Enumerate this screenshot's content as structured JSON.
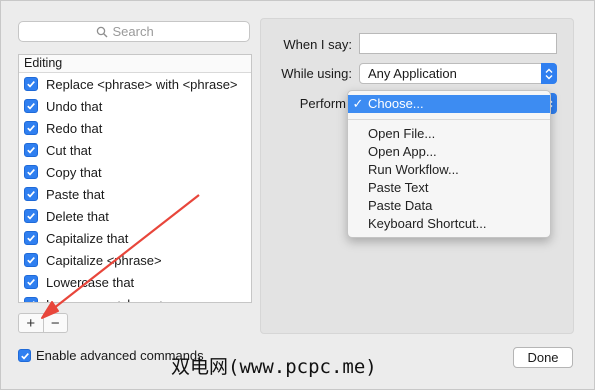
{
  "search": {
    "placeholder": "Search"
  },
  "list": {
    "header": "Editing",
    "items": [
      {
        "label": "Replace <phrase> with <phrase>",
        "checked": true
      },
      {
        "label": "Undo that",
        "checked": true
      },
      {
        "label": "Redo that",
        "checked": true
      },
      {
        "label": "Cut that",
        "checked": true
      },
      {
        "label": "Copy that",
        "checked": true
      },
      {
        "label": "Paste that",
        "checked": true
      },
      {
        "label": "Delete that",
        "checked": true
      },
      {
        "label": "Capitalize that",
        "checked": true
      },
      {
        "label": "Capitalize <phrase>",
        "checked": true
      },
      {
        "label": "Lowercase that",
        "checked": true
      },
      {
        "label": "Lowercase <phrase>",
        "checked": true
      }
    ]
  },
  "buttons": {
    "add": "+",
    "remove": "−",
    "done": "Done"
  },
  "form": {
    "when_i_say_label": "When I say:",
    "when_i_say_value": "",
    "while_using_label": "While using:",
    "while_using_value": "Any Application",
    "perform_label": "Perform"
  },
  "menu": {
    "selected": "Choose...",
    "check": "✓",
    "items": [
      "Open File...",
      "Open App...",
      "Run Workflow...",
      "Paste Text",
      "Paste Data",
      "Keyboard Shortcut..."
    ]
  },
  "enable_advanced": {
    "label": "Enable advanced commands",
    "checked": true
  },
  "watermark": "双电网(www.pcpc.me)",
  "colors": {
    "accent": "#2f7ff0",
    "arrow": "#e8463b",
    "menu_highlight": "#3d8cf2"
  },
  "icons": {
    "search": "magnifier-icon",
    "checkbox": "checkmark-icon",
    "popup": "updown-chevron-icon"
  }
}
